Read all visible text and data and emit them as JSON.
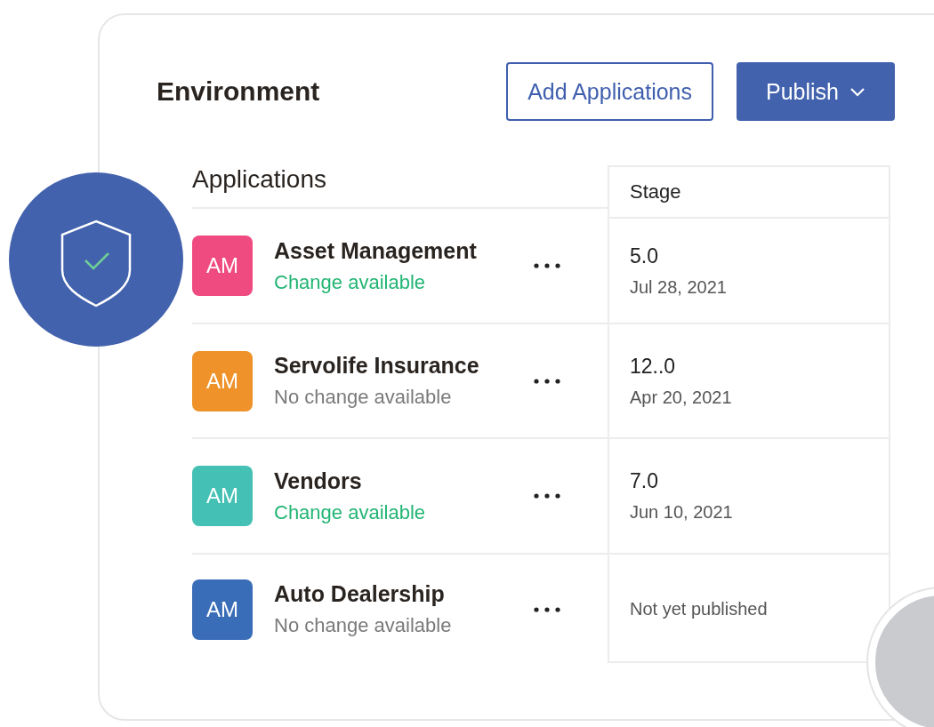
{
  "panel": {
    "title": "Environment",
    "buttons": [
      {
        "label": "Add Applications",
        "kind": "outline"
      },
      {
        "label": "Publish",
        "kind": "dropdown"
      }
    ]
  },
  "applications": {
    "heading": "Applications",
    "stage_heading": "Stage",
    "rows": [
      {
        "initials": "AM",
        "color": "#ef4b80",
        "name": "Asset Management",
        "status": "Change available",
        "change_available": true,
        "stage": {
          "kind": "published",
          "version": "5.0",
          "date": "Jul 28, 2021"
        }
      },
      {
        "initials": "AM",
        "color": "#ef9229",
        "name": "Servolife Insurance",
        "status": "No change available",
        "change_available": false,
        "stage": {
          "kind": "published",
          "version": "12..0",
          "date": "Apr 20, 2021"
        }
      },
      {
        "initials": "AM",
        "color": "#44c0b4",
        "name": "Vendors",
        "status": "Change available",
        "change_available": true,
        "stage": {
          "kind": "published",
          "version": "7.0",
          "date": "Jun 10, 2021"
        }
      },
      {
        "initials": "AM",
        "color": "#3a6db8",
        "name": "Auto Dealership",
        "status": "No change available",
        "change_available": false,
        "stage": {
          "kind": "unpublished",
          "note": "Not yet published"
        }
      }
    ]
  }
}
